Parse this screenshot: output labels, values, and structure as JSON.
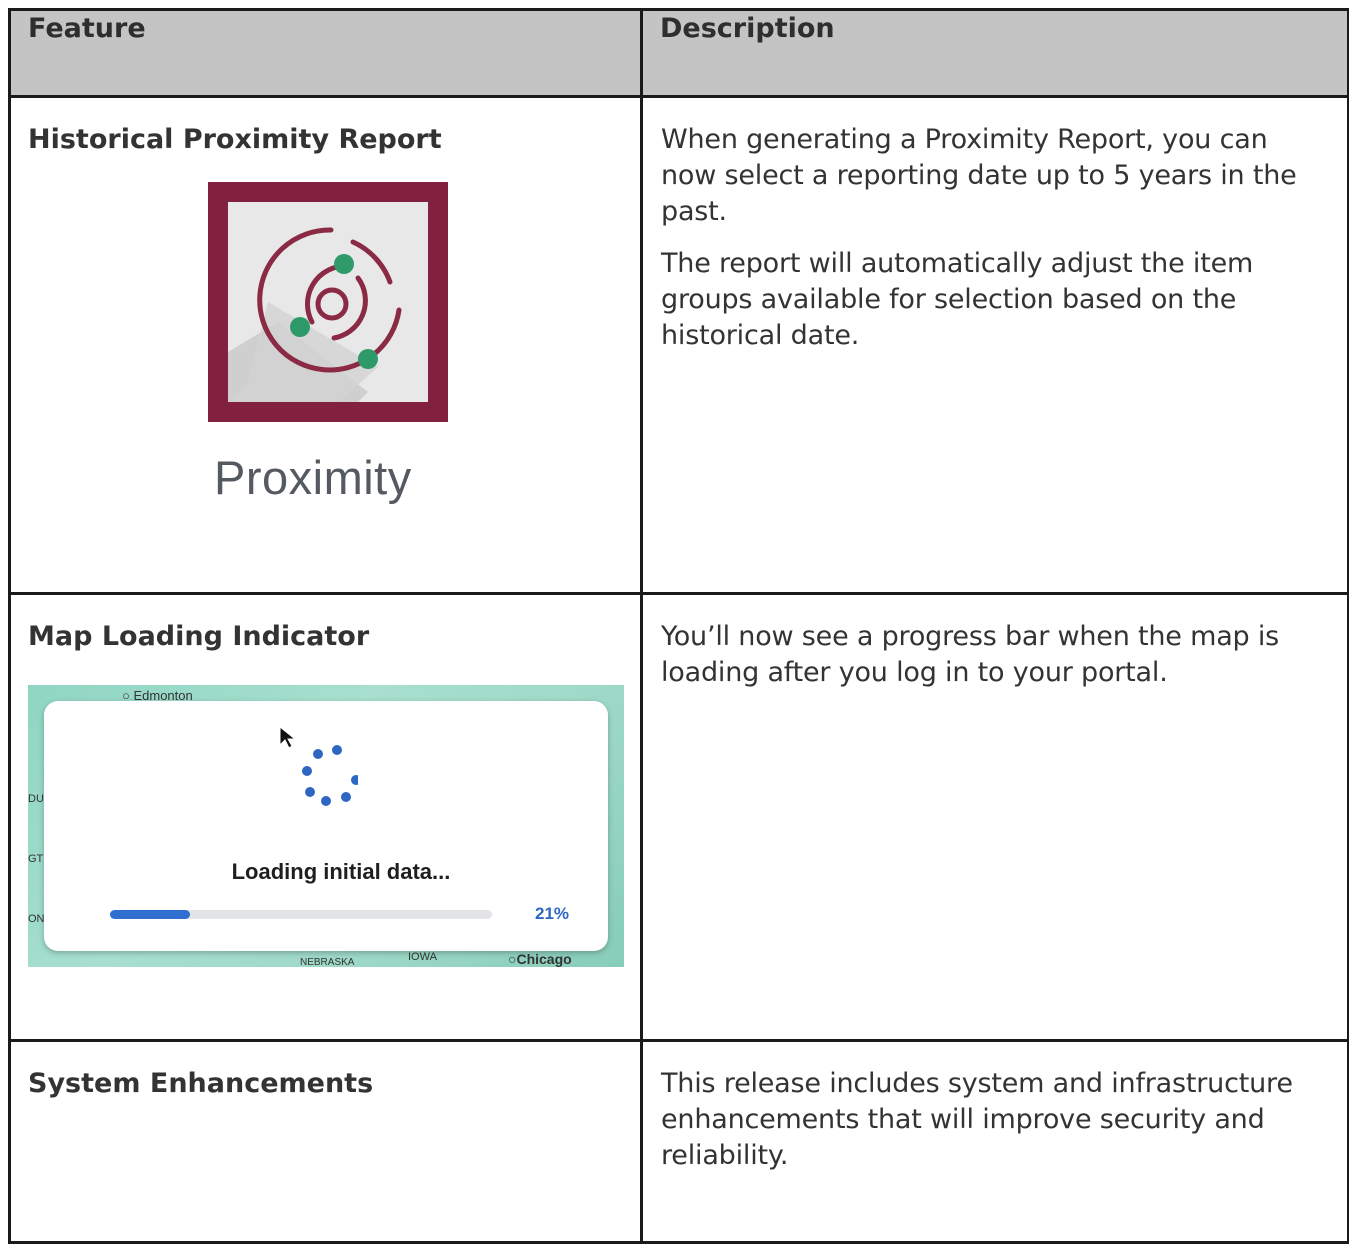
{
  "headers": {
    "feature": "Feature",
    "description": "Description"
  },
  "rows": [
    {
      "feature": "Historical Proximity Report",
      "description": [
        "When generating a Proximity Report, you can now select a reporting date up to 5 years in the past.",
        "The report will automatically adjust the item groups available for selection based on the historical date."
      ]
    },
    {
      "feature": "Map Loading Indicator",
      "description": [
        "You’ll now see a progress bar when the map is loading after you log in to your portal."
      ]
    },
    {
      "feature": "System Enhancements",
      "description": [
        "This release includes system and infrastructure enhancements that will improve security and reliability."
      ]
    }
  ],
  "proximity_logo": {
    "label": "Proximity",
    "icon": "proximity-icon",
    "colors": {
      "frame": "#82213f",
      "panel": "#e8e8e8",
      "shadow": "#cfcfcf",
      "ring": "#8a2a45",
      "dot": "#2e9a6a"
    }
  },
  "map_loading": {
    "loading_text": "Loading initial data...",
    "progress_percent_label": "21%",
    "progress_fraction": 0.21,
    "map_labels": {
      "edmonton": "Edmonton",
      "chicago": "Chicago",
      "iowa": "IOWA",
      "nebraska": "NEBRASKA",
      "edge1": "DU",
      "edge2": "GT",
      "edge3": "ON"
    },
    "colors": {
      "accent": "#2f6fd0",
      "spinner": "#2f66c4"
    }
  }
}
